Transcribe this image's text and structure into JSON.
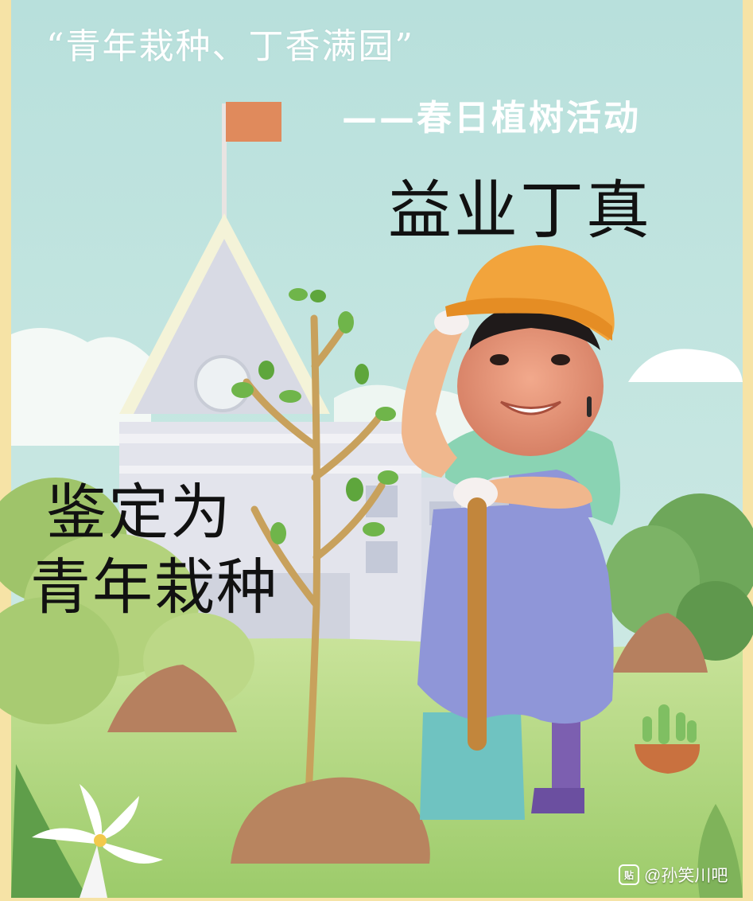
{
  "poster": {
    "title": "“青年栽种、丁香满园”",
    "subtitle": "——春日植树活动",
    "caption_top": "益业丁真",
    "caption_bottom_line1": "鉴定为",
    "caption_bottom_line2": "青年栽种",
    "watermark": "@孙笑川吧",
    "watermark_icon_label": "贴"
  },
  "colors": {
    "sky": "#bfe3df",
    "frame": "#f6e3a6",
    "grass": "#a9cf7b",
    "overalls": "#8f96d8",
    "hat": "#f2a43c",
    "flag": "#e08a5c"
  },
  "icons": {
    "watermark": "tieba-icon"
  }
}
